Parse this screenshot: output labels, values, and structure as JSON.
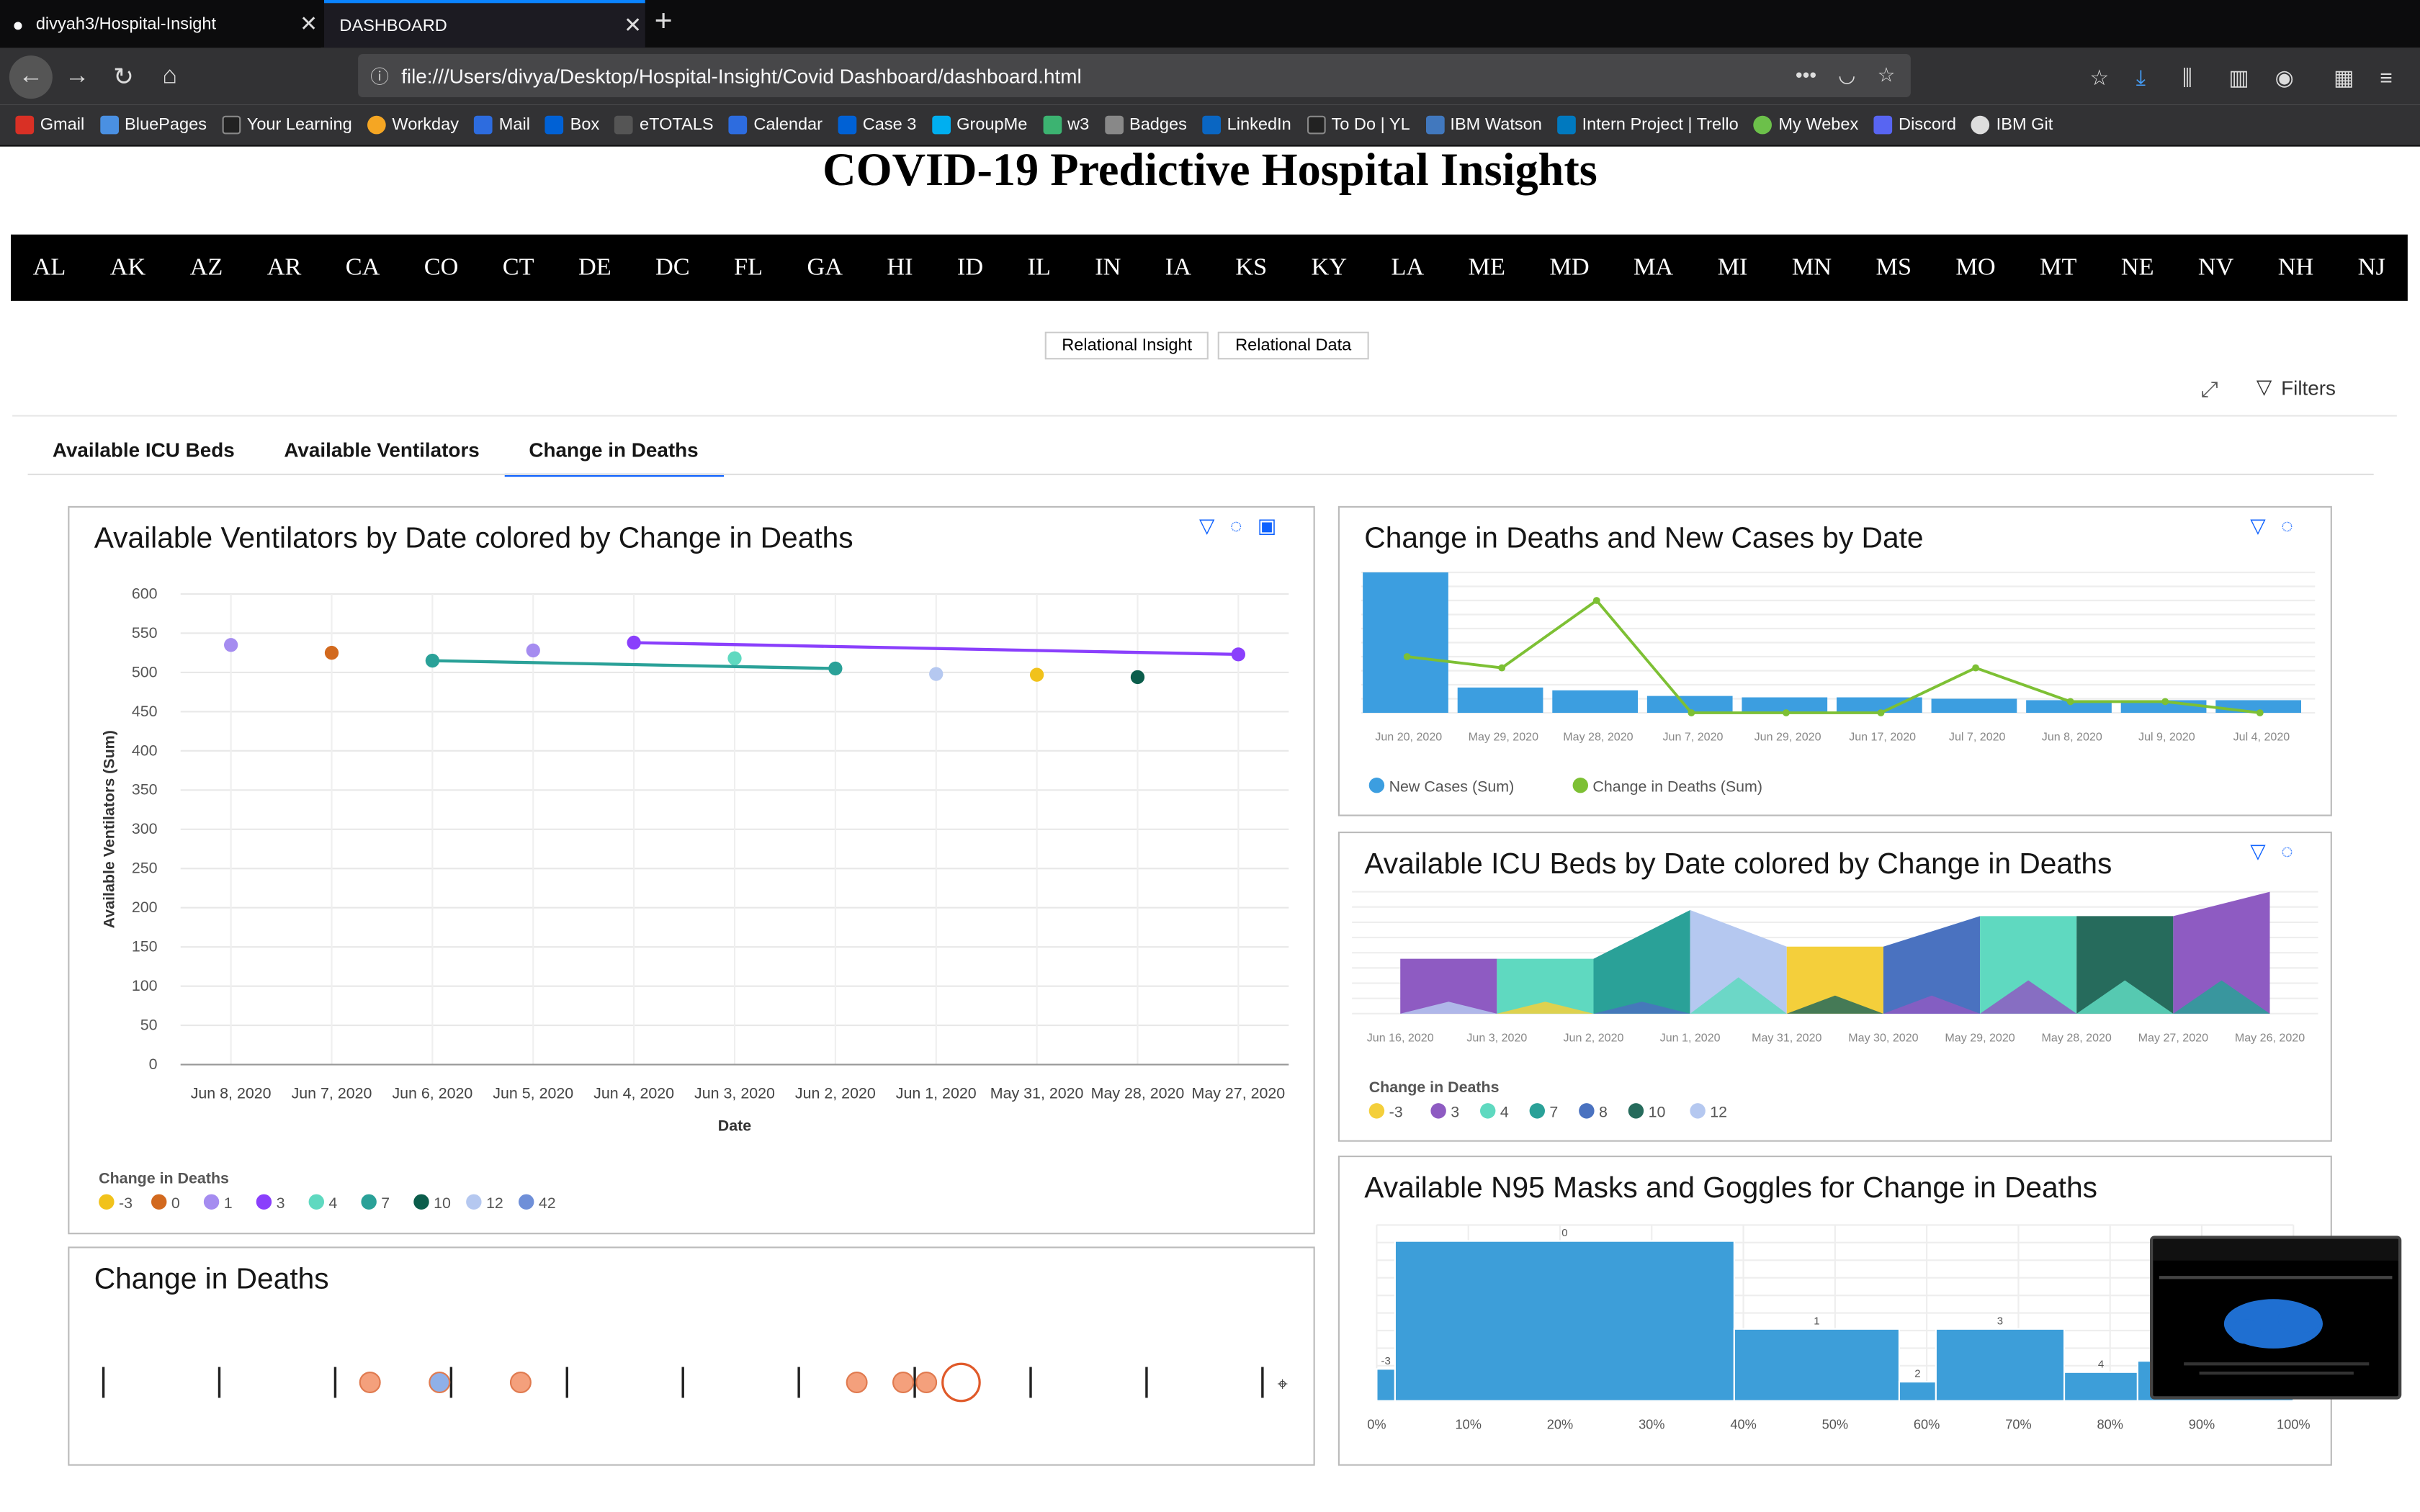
{
  "browser": {
    "tabs": [
      {
        "title": "divyah3/Hospital-Insight"
      },
      {
        "title": "DASHBOARD"
      }
    ],
    "url": "file:///Users/divya/Desktop/Hospital-Insight/Covid Dashboard/dashboard.html",
    "bookmarks": [
      "Gmail",
      "BluePages",
      "Your Learning",
      "Workday",
      "Mail",
      "Box",
      "eTOTALS",
      "Calendar",
      "Case 3",
      "GroupMe",
      "w3",
      "Badges",
      "LinkedIn",
      "To Do | YL",
      "IBM Watson",
      "Intern Project | Trello",
      "My Webex",
      "Discord",
      "IBM Git"
    ]
  },
  "page": {
    "title": "COVID-19 Predictive Hospital Insights",
    "states": [
      "AL",
      "AK",
      "AZ",
      "AR",
      "CA",
      "CO",
      "CT",
      "DE",
      "DC",
      "FL",
      "GA",
      "HI",
      "ID",
      "IL",
      "IN",
      "IA",
      "KS",
      "KY",
      "LA",
      "ME",
      "MD",
      "MA",
      "MI",
      "MN",
      "MS",
      "MO",
      "MT",
      "NE",
      "NV",
      "NH",
      "NJ"
    ],
    "toggle_insight": "Relational Insight",
    "toggle_data": "Relational Data",
    "filters_label": "Filters",
    "tabs": [
      "Available ICU Beds",
      "Available Ventilators",
      "Change in Deaths"
    ]
  },
  "chart_data": [
    {
      "type": "scatter",
      "title": "Available Ventilators by Date colored by Change in Deaths",
      "xlabel": "Date",
      "ylabel": "Available Ventilators (Sum)",
      "ylim": [
        0,
        600
      ],
      "yticks": [
        0,
        50,
        100,
        150,
        200,
        250,
        300,
        350,
        400,
        450,
        500,
        550,
        600
      ],
      "categories": [
        "Jun 8, 2020",
        "Jun 7, 2020",
        "Jun 6, 2020",
        "Jun 5, 2020",
        "Jun 4, 2020",
        "Jun 3, 2020",
        "Jun 2, 2020",
        "Jun 1, 2020",
        "May 31, 2020",
        "May 28, 2020",
        "May 27, 2020"
      ],
      "legend_title": "Change in Deaths",
      "legend": [
        {
          "label": "-3",
          "color": "#f1c21b"
        },
        {
          "label": "0",
          "color": "#d2691e"
        },
        {
          "label": "1",
          "color": "#a58cf0"
        },
        {
          "label": "3",
          "color": "#8a3ffc"
        },
        {
          "label": "4",
          "color": "#5fd9c0"
        },
        {
          "label": "7",
          "color": "#2aa198"
        },
        {
          "label": "10",
          "color": "#0b5d4b"
        },
        {
          "label": "12",
          "color": "#b5c8f0"
        },
        {
          "label": "42",
          "color": "#6f8fd8"
        }
      ],
      "points": [
        {
          "x": "Jun 8, 2020",
          "y": 535,
          "color": "#a58cf0"
        },
        {
          "x": "Jun 7, 2020",
          "y": 525,
          "color": "#d2691e"
        },
        {
          "x": "Jun 6, 2020",
          "y": 515,
          "color": "#2aa198"
        },
        {
          "x": "Jun 5, 2020",
          "y": 528,
          "color": "#a58cf0"
        },
        {
          "x": "Jun 4, 2020",
          "y": 538,
          "color": "#8a3ffc"
        },
        {
          "x": "Jun 3, 2020",
          "y": 518,
          "color": "#5fd9c0"
        },
        {
          "x": "Jun 2, 2020",
          "y": 505,
          "color": "#2aa198"
        },
        {
          "x": "Jun 1, 2020",
          "y": 498,
          "color": "#b5c8f0"
        },
        {
          "x": "May 31, 2020",
          "y": 497,
          "color": "#f1c21b"
        },
        {
          "x": "May 28, 2020",
          "y": 494,
          "color": "#0b5d4b"
        },
        {
          "x": "May 27, 2020",
          "y": 523,
          "color": "#8a3ffc"
        }
      ],
      "lines": [
        {
          "color": "#2aa198",
          "from": [
            "Jun 6, 2020",
            515
          ],
          "to": [
            "Jun 2, 2020",
            505
          ]
        },
        {
          "color": "#8a3ffc",
          "from": [
            "Jun 4, 2020",
            538
          ],
          "to": [
            "May 27, 2020",
            523
          ]
        }
      ]
    },
    {
      "type": "bar",
      "title": "Change in Deaths and New Cases by Date",
      "categories": [
        "Jun 20, 2020",
        "May 29, 2020",
        "May 28, 2020",
        "Jun 7, 2020",
        "Jun 29, 2020",
        "Jun 17, 2020",
        "Jul 7, 2020",
        "Jun 8, 2020",
        "Jul 9, 2020",
        "Jul 4, 2020"
      ],
      "series": [
        {
          "name": "New Cases (Sum)",
          "type": "bar",
          "color": "#3c9ee0",
          "values": [
            100,
            18,
            16,
            12,
            11,
            11,
            10,
            9,
            9,
            9
          ]
        },
        {
          "name": "Change in Deaths (Sum)",
          "type": "line",
          "color": "#7dc034",
          "values": [
            40,
            32,
            80,
            0,
            0,
            0,
            32,
            8,
            8,
            0
          ]
        }
      ],
      "ylim": [
        0,
        100
      ]
    },
    {
      "type": "area",
      "title": "Available ICU Beds by Date colored by Change in Deaths",
      "categories": [
        "Jun 16, 2020",
        "Jun 3, 2020",
        "Jun 2, 2020",
        "Jun 1, 2020",
        "May 31, 2020",
        "May 30, 2020",
        "May 29, 2020",
        "May 28, 2020",
        "May 27, 2020",
        "May 26, 2020"
      ],
      "legend_title": "Change in Deaths",
      "legend": [
        {
          "label": "-3",
          "color": "#f4cf3b"
        },
        {
          "label": "3",
          "color": "#8e5bc2"
        },
        {
          "label": "4",
          "color": "#5fd9c0"
        },
        {
          "label": "7",
          "color": "#2aa198"
        },
        {
          "label": "8",
          "color": "#4a72c0"
        },
        {
          "label": "10",
          "color": "#266b5c"
        },
        {
          "label": "12",
          "color": "#b5c8f0"
        }
      ],
      "values": [
        45,
        45,
        45,
        85,
        55,
        55,
        80,
        80,
        80,
        100
      ]
    },
    {
      "type": "bar",
      "title": "Available N95 Masks and Goggles for Change in Deaths",
      "xticks": [
        "0%",
        "10%",
        "20%",
        "30%",
        "40%",
        "50%",
        "60%",
        "70%",
        "80%",
        "90%",
        "100%"
      ],
      "bars": [
        {
          "label": "-3",
          "from": 0,
          "to": 2,
          "value": 20
        },
        {
          "label": "0",
          "from": 2,
          "to": 39,
          "value": 100
        },
        {
          "label": "1",
          "from": 39,
          "to": 57,
          "value": 45
        },
        {
          "label": "2",
          "from": 57,
          "to": 61,
          "value": 12
        },
        {
          "label": "3",
          "from": 61,
          "to": 75,
          "value": 45
        },
        {
          "label": "4",
          "from": 75,
          "to": 83,
          "value": 18
        },
        {
          "label": "",
          "from": 83,
          "to": 100,
          "value": 25
        }
      ],
      "ylim": [
        0,
        110
      ]
    },
    {
      "type": "scatter",
      "title": "Change in Deaths",
      "ticks": 11,
      "points": [
        {
          "pos": 0.23,
          "color": "#f4a07c"
        },
        {
          "pos": 0.29,
          "color": "#8fb0e8"
        },
        {
          "pos": 0.36,
          "color": "#f4a07c"
        },
        {
          "pos": 0.65,
          "color": "#f4a07c"
        },
        {
          "pos": 0.69,
          "color": "#f4a07c"
        },
        {
          "pos": 0.71,
          "color": "#f4a07c"
        }
      ]
    }
  ]
}
